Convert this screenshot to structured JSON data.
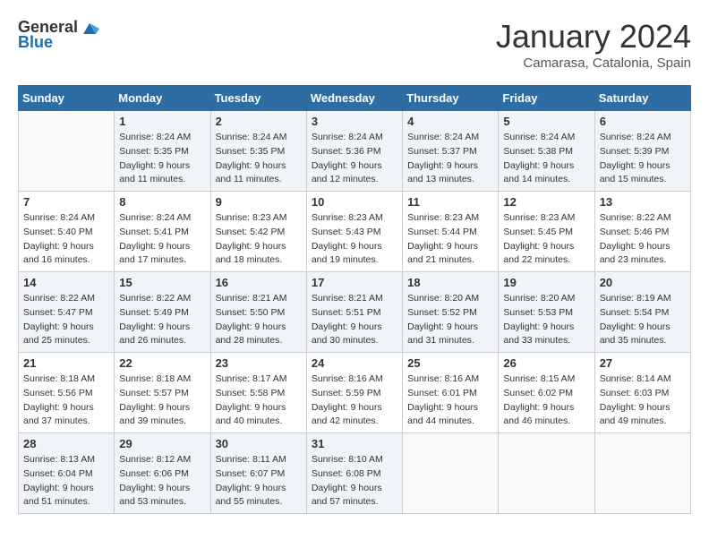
{
  "logo": {
    "general": "General",
    "blue": "Blue"
  },
  "header": {
    "title": "January 2024",
    "subtitle": "Camarasa, Catalonia, Spain"
  },
  "weekdays": [
    "Sunday",
    "Monday",
    "Tuesday",
    "Wednesday",
    "Thursday",
    "Friday",
    "Saturday"
  ],
  "weeks": [
    [
      {
        "day": "",
        "info": ""
      },
      {
        "day": "1",
        "info": "Sunrise: 8:24 AM\nSunset: 5:35 PM\nDaylight: 9 hours\nand 11 minutes."
      },
      {
        "day": "2",
        "info": "Sunrise: 8:24 AM\nSunset: 5:35 PM\nDaylight: 9 hours\nand 11 minutes."
      },
      {
        "day": "3",
        "info": "Sunrise: 8:24 AM\nSunset: 5:36 PM\nDaylight: 9 hours\nand 12 minutes."
      },
      {
        "day": "4",
        "info": "Sunrise: 8:24 AM\nSunset: 5:37 PM\nDaylight: 9 hours\nand 13 minutes."
      },
      {
        "day": "5",
        "info": "Sunrise: 8:24 AM\nSunset: 5:38 PM\nDaylight: 9 hours\nand 14 minutes."
      },
      {
        "day": "6",
        "info": "Sunrise: 8:24 AM\nSunset: 5:39 PM\nDaylight: 9 hours\nand 15 minutes."
      }
    ],
    [
      {
        "day": "7",
        "info": "Sunrise: 8:24 AM\nSunset: 5:40 PM\nDaylight: 9 hours\nand 16 minutes."
      },
      {
        "day": "8",
        "info": "Sunrise: 8:24 AM\nSunset: 5:41 PM\nDaylight: 9 hours\nand 17 minutes."
      },
      {
        "day": "9",
        "info": "Sunrise: 8:23 AM\nSunset: 5:42 PM\nDaylight: 9 hours\nand 18 minutes."
      },
      {
        "day": "10",
        "info": "Sunrise: 8:23 AM\nSunset: 5:43 PM\nDaylight: 9 hours\nand 19 minutes."
      },
      {
        "day": "11",
        "info": "Sunrise: 8:23 AM\nSunset: 5:44 PM\nDaylight: 9 hours\nand 21 minutes."
      },
      {
        "day": "12",
        "info": "Sunrise: 8:23 AM\nSunset: 5:45 PM\nDaylight: 9 hours\nand 22 minutes."
      },
      {
        "day": "13",
        "info": "Sunrise: 8:22 AM\nSunset: 5:46 PM\nDaylight: 9 hours\nand 23 minutes."
      }
    ],
    [
      {
        "day": "14",
        "info": "Sunrise: 8:22 AM\nSunset: 5:47 PM\nDaylight: 9 hours\nand 25 minutes."
      },
      {
        "day": "15",
        "info": "Sunrise: 8:22 AM\nSunset: 5:49 PM\nDaylight: 9 hours\nand 26 minutes."
      },
      {
        "day": "16",
        "info": "Sunrise: 8:21 AM\nSunset: 5:50 PM\nDaylight: 9 hours\nand 28 minutes."
      },
      {
        "day": "17",
        "info": "Sunrise: 8:21 AM\nSunset: 5:51 PM\nDaylight: 9 hours\nand 30 minutes."
      },
      {
        "day": "18",
        "info": "Sunrise: 8:20 AM\nSunset: 5:52 PM\nDaylight: 9 hours\nand 31 minutes."
      },
      {
        "day": "19",
        "info": "Sunrise: 8:20 AM\nSunset: 5:53 PM\nDaylight: 9 hours\nand 33 minutes."
      },
      {
        "day": "20",
        "info": "Sunrise: 8:19 AM\nSunset: 5:54 PM\nDaylight: 9 hours\nand 35 minutes."
      }
    ],
    [
      {
        "day": "21",
        "info": "Sunrise: 8:18 AM\nSunset: 5:56 PM\nDaylight: 9 hours\nand 37 minutes."
      },
      {
        "day": "22",
        "info": "Sunrise: 8:18 AM\nSunset: 5:57 PM\nDaylight: 9 hours\nand 39 minutes."
      },
      {
        "day": "23",
        "info": "Sunrise: 8:17 AM\nSunset: 5:58 PM\nDaylight: 9 hours\nand 40 minutes."
      },
      {
        "day": "24",
        "info": "Sunrise: 8:16 AM\nSunset: 5:59 PM\nDaylight: 9 hours\nand 42 minutes."
      },
      {
        "day": "25",
        "info": "Sunrise: 8:16 AM\nSunset: 6:01 PM\nDaylight: 9 hours\nand 44 minutes."
      },
      {
        "day": "26",
        "info": "Sunrise: 8:15 AM\nSunset: 6:02 PM\nDaylight: 9 hours\nand 46 minutes."
      },
      {
        "day": "27",
        "info": "Sunrise: 8:14 AM\nSunset: 6:03 PM\nDaylight: 9 hours\nand 49 minutes."
      }
    ],
    [
      {
        "day": "28",
        "info": "Sunrise: 8:13 AM\nSunset: 6:04 PM\nDaylight: 9 hours\nand 51 minutes."
      },
      {
        "day": "29",
        "info": "Sunrise: 8:12 AM\nSunset: 6:06 PM\nDaylight: 9 hours\nand 53 minutes."
      },
      {
        "day": "30",
        "info": "Sunrise: 8:11 AM\nSunset: 6:07 PM\nDaylight: 9 hours\nand 55 minutes."
      },
      {
        "day": "31",
        "info": "Sunrise: 8:10 AM\nSunset: 6:08 PM\nDaylight: 9 hours\nand 57 minutes."
      },
      {
        "day": "",
        "info": ""
      },
      {
        "day": "",
        "info": ""
      },
      {
        "day": "",
        "info": ""
      }
    ]
  ]
}
